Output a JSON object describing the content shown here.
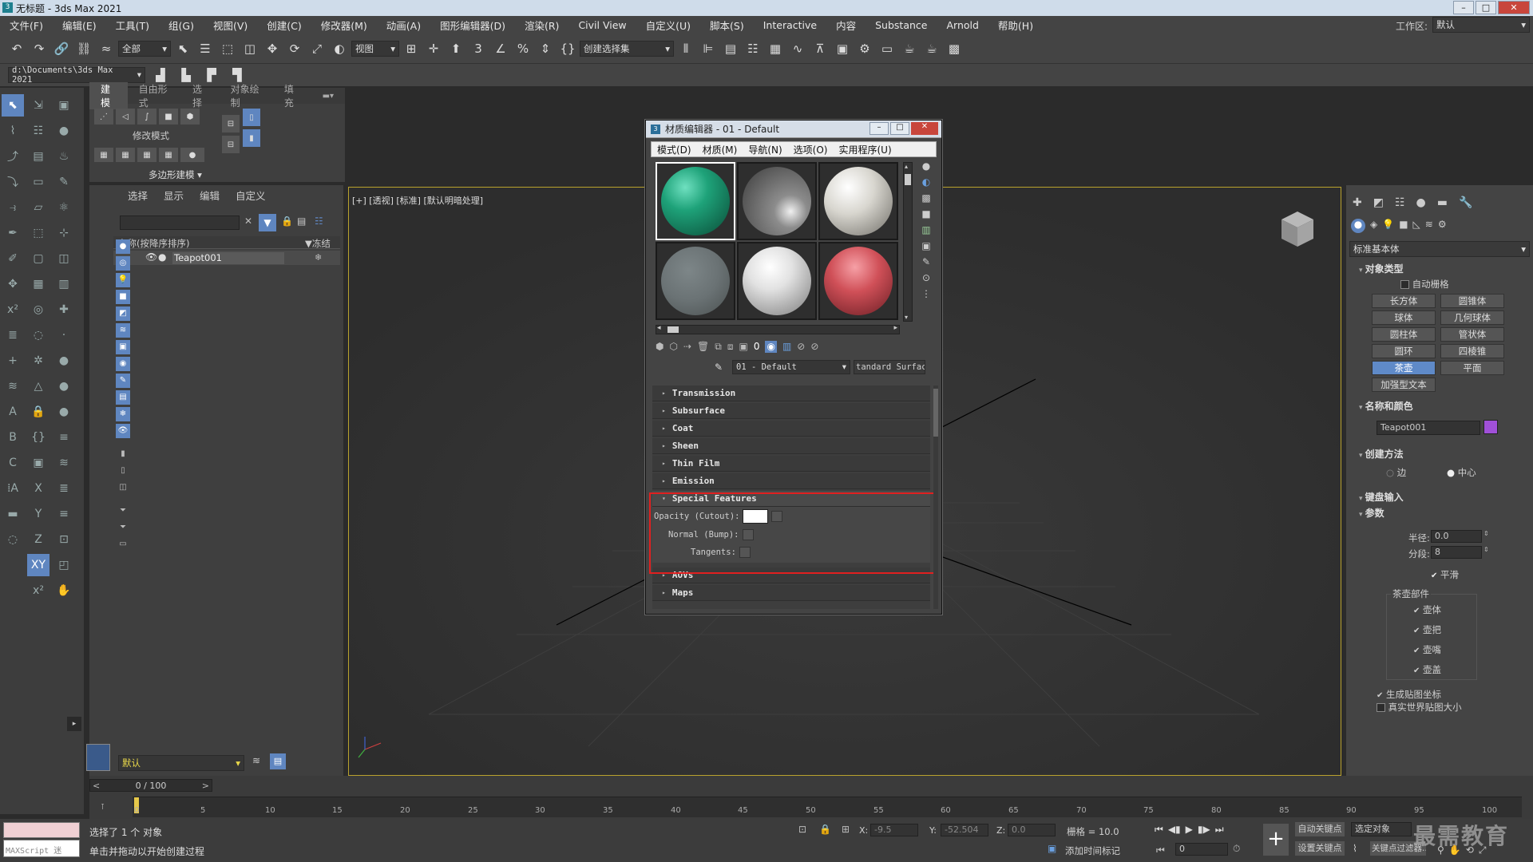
{
  "app": {
    "title": "无标题 - 3ds Max 2021"
  },
  "menubar": {
    "items": [
      "文件(F)",
      "编辑(E)",
      "工具(T)",
      "组(G)",
      "视图(V)",
      "创建(C)",
      "修改器(M)",
      "动画(A)",
      "图形编辑器(D)",
      "渲染(R)",
      "Civil View",
      "自定义(U)",
      "脚本(S)",
      "Interactive",
      "内容",
      "Substance",
      "Arnold",
      "帮助(H)"
    ],
    "workspace_label": "工作区:",
    "workspace_value": "默认"
  },
  "toolbar": {
    "filter": "全部",
    "refcoord": "视图",
    "selset": "创建选择集"
  },
  "toolbar2": {
    "path": "d:\\Documents\\3ds Max 2021"
  },
  "ribbon": {
    "tabs": [
      "建模",
      "自由形式",
      "选择",
      "对象绘制",
      "填充"
    ],
    "mode_label": "修改模式",
    "poly_label": "多边形建模"
  },
  "scene": {
    "tabs": [
      "选择",
      "显示",
      "编辑",
      "自定义"
    ],
    "col_name": "名称(按降序排序)",
    "col_freeze": "▼冻结",
    "object": "Teapot001",
    "layer": "默认"
  },
  "viewport": {
    "label": "[+] [透视] [标准] [默认明暗处理]"
  },
  "material_editor": {
    "title": "材质编辑器 - 01 - Default",
    "menu": [
      "模式(D)",
      "材质(M)",
      "导航(N)",
      "选项(O)",
      "实用程序(U)"
    ],
    "material_name": "01 - Default",
    "material_type": "tandard Surfac",
    "spheres": [
      "#1ea279",
      "#8c8c8c",
      "#d8d6cf",
      "#6a7274",
      "#e2e2e2",
      "#d05058"
    ],
    "rollouts_top": [
      "Transmission",
      "Subsurface",
      "Coat",
      "Sheen",
      "Thin Film",
      "Emission"
    ],
    "special": {
      "title": "Special Features",
      "opacity": "Opacity (Cutout):",
      "normal": "Normal (Bump):",
      "tangents": "Tangents:"
    },
    "rollouts_bottom": [
      "AOVs",
      "Maps"
    ],
    "highlight_color": "#e02020"
  },
  "cmdpanel": {
    "dropdown": "标准基本体",
    "obj_type_title": "对象类型",
    "autogrid": "自动栅格",
    "buttons": [
      "长方体",
      "圆锥体",
      "球体",
      "几何球体",
      "圆柱体",
      "管状体",
      "圆环",
      "四棱锥",
      "茶壶",
      "平面",
      "加强型文本"
    ],
    "active_button": "茶壶",
    "name_color_title": "名称和颜色",
    "object_name": "Teapot001",
    "object_color": "#a050d8",
    "creation_title": "创建方法",
    "creation_edge": "边",
    "creation_center": "中心",
    "kbd_title": "键盘输入",
    "params_title": "参数",
    "radius_label": "半径:",
    "radius_value": "0.0",
    "segments_label": "分段:",
    "segments_value": "8",
    "smooth": "平滑",
    "parts_title": "茶壶部件",
    "parts": [
      "壶体",
      "壶把",
      "壶嘴",
      "壶盖"
    ],
    "gen_map": "生成贴图坐标",
    "real_world": "真实世界贴图大小"
  },
  "timeline": {
    "frame": "0 / 100",
    "ticks": [
      "0",
      "5",
      "10",
      "15",
      "20",
      "25",
      "30",
      "35",
      "40",
      "45",
      "50",
      "55",
      "60",
      "65",
      "70",
      "75",
      "80",
      "85",
      "90",
      "95",
      "100"
    ]
  },
  "status": {
    "maxscript": "MAXScript 迷",
    "selected": "选择了 1 个 对象",
    "prompt": "单击并拖动以开始创建过程",
    "x_label": "X:",
    "x_value": "-9.5",
    "y_label": "Y:",
    "y_value": "-52.504",
    "z_label": "Z:",
    "z_value": "0.0",
    "grid": "栅格 = 10.0",
    "add_time_tag": "添加时间标记",
    "auto_key": "自动关键点",
    "set_key": "设置关键点",
    "selected_obj": "选定对象",
    "key_filter": "关键点过滤器...",
    "frame_value": "0",
    "watermark": "最需教育"
  }
}
